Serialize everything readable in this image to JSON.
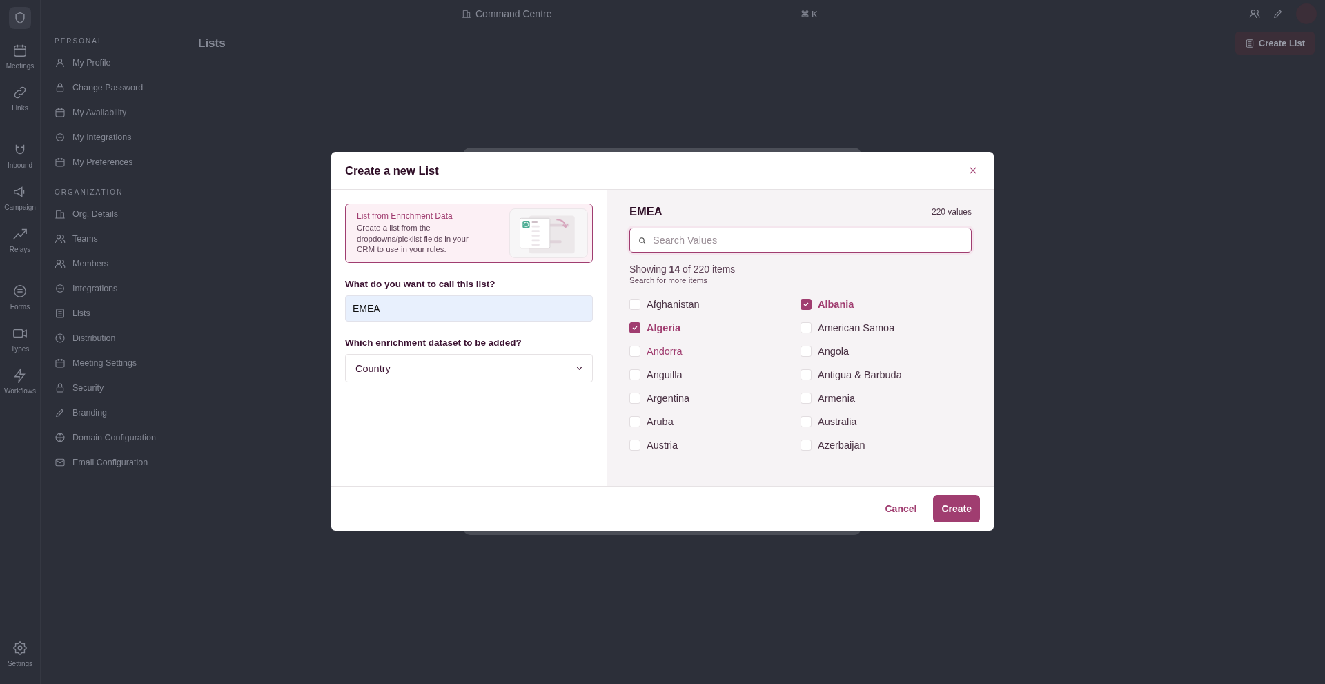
{
  "top_bar": {
    "breadcrumb": "Command Centre",
    "shortcut": "⌘ K"
  },
  "rail": {
    "groups": [
      [
        "Meetings",
        "Links"
      ],
      [
        "Inbound",
        "Campaign",
        "Relays"
      ],
      [
        "Forms",
        "Types",
        "Workflows"
      ]
    ],
    "footer": "Settings"
  },
  "settings_nav": [
    {
      "heading": "PERSONAL",
      "items": [
        "My Profile",
        "Change Password",
        "My Availability",
        "My Integrations",
        "My Preferences"
      ]
    },
    {
      "heading": "ORGANIZATION",
      "items": [
        "Org. Details",
        "Teams",
        "Members",
        "Integrations",
        "Lists",
        "Distribution",
        "Meeting Settings",
        "Security",
        "Branding",
        "Domain Configuration",
        "Email Configuration"
      ]
    }
  ],
  "page": {
    "title": "Lists",
    "action": "Create List"
  },
  "modal": {
    "title": "Create a new List",
    "source_card": {
      "title": "List from Enrichment Data",
      "description": "Create a list from the dropdowns/picklist fields in your CRM to use in your rules."
    },
    "name_label": "What do you want to call this list?",
    "name_value": "EMEA",
    "dataset_label": "Which enrichment dataset to be added?",
    "dataset_value": "Country",
    "preview": {
      "title": "EMEA",
      "count": "220 values",
      "search_placeholder": "Search Values",
      "showing": "Showing **14** of 220 items",
      "hint": "Search for more items",
      "items": [
        {
          "label": "Afghanistan",
          "checked": false,
          "hovered": false
        },
        {
          "label": "Albania",
          "checked": true,
          "hovered": false
        },
        {
          "label": "Algeria",
          "checked": true,
          "hovered": false
        },
        {
          "label": "American Samoa",
          "checked": false,
          "hovered": false
        },
        {
          "label": "Andorra",
          "checked": false,
          "hovered": true
        },
        {
          "label": "Angola",
          "checked": false,
          "hovered": false
        },
        {
          "label": "Anguilla",
          "checked": false,
          "hovered": false
        },
        {
          "label": "Antigua & Barbuda",
          "checked": false,
          "hovered": false
        },
        {
          "label": "Argentina",
          "checked": false,
          "hovered": false
        },
        {
          "label": "Armenia",
          "checked": false,
          "hovered": false
        },
        {
          "label": "Aruba",
          "checked": false,
          "hovered": false
        },
        {
          "label": "Australia",
          "checked": false,
          "hovered": false
        },
        {
          "label": "Austria",
          "checked": false,
          "hovered": false
        },
        {
          "label": "Azerbaijan",
          "checked": false,
          "hovered": false
        }
      ]
    },
    "buttons": {
      "cancel": "Cancel",
      "create": "Create"
    }
  }
}
